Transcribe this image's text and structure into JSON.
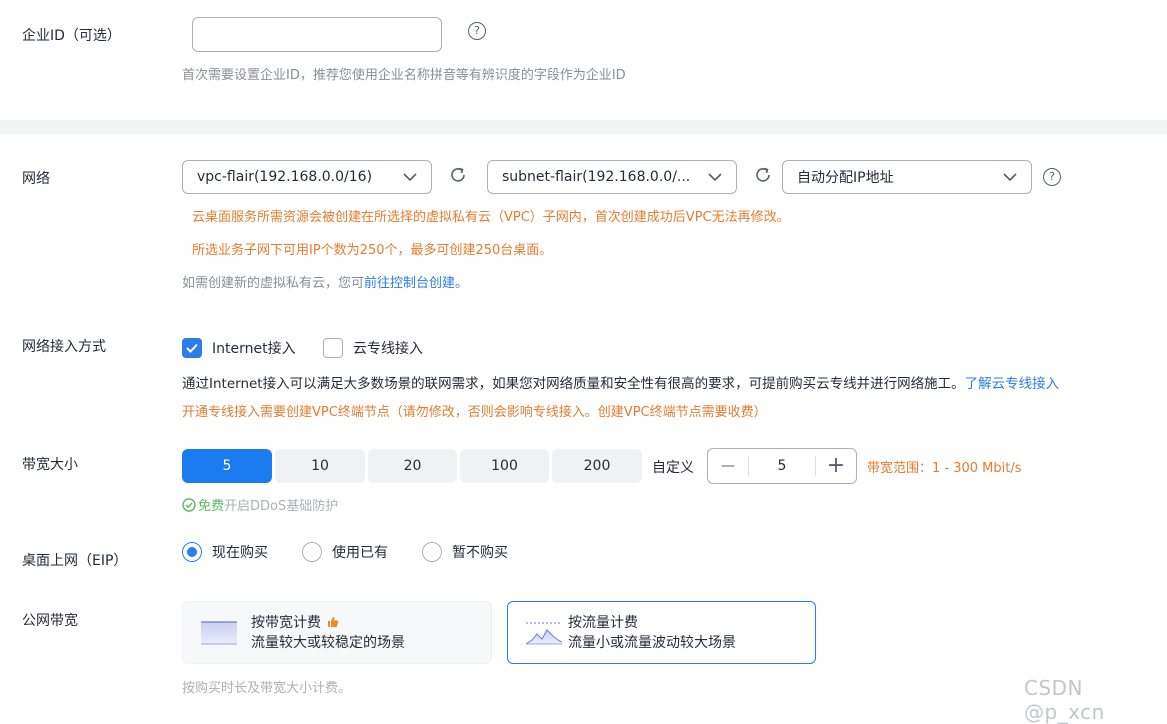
{
  "enterprise": {
    "label": "企业ID（可选）",
    "input_value": "",
    "input_placeholder": "",
    "hint": "首次需要设置企业ID，推荐您使用企业名称拼音等有辨识度的字段作为企业ID"
  },
  "network": {
    "label": "网络",
    "vpc_value": "vpc-flair(192.168.0.0/16)",
    "subnet_value": "subnet-flair(192.168.0.0/...",
    "ip_value": "自动分配IP地址",
    "warning1": "云桌面服务所需资源会被创建在所选择的虚拟私有云（VPC）子网内，首次创建成功后VPC无法再修改。",
    "warning2": "所选业务子网下可用IP个数为250个，最多可创建250台桌面。",
    "create_hint": "如需创建新的虚拟私有云，您可",
    "create_link": "前往控制台创建。"
  },
  "access": {
    "label": "网络接入方式",
    "option_internet": "Internet接入",
    "option_direct": "云专线接入",
    "desc": "通过Internet接入可以满足大多数场景的联网需求，如果您对网络质量和安全性有很高的要求，可提前购买云专线并进行网络施工。",
    "desc_link": "了解云专线接入",
    "warning": "开通专线接入需要创建VPC终端节点（请勿修改，否则会影响专线接入。创建VPC终端节点需要收费）"
  },
  "bandwidth": {
    "label": "带宽大小",
    "options": [
      "5",
      "10",
      "20",
      "100",
      "200"
    ],
    "selected": "5",
    "custom_label": "自定义",
    "stepper_value": "5",
    "minus": "—",
    "plus": "+",
    "range": "带宽范围：1 - 300 Mbit/s",
    "ddos_free": "免费",
    "ddos_text": "开启DDoS基础防护"
  },
  "eip": {
    "label": "桌面上网（EIP）",
    "options": [
      "现在购买",
      "使用已有",
      "暂不购买"
    ],
    "selected": "现在购买"
  },
  "public_bw": {
    "label": "公网带宽",
    "card1_title": "按带宽计费",
    "card1_desc": "流量较大或较稳定的场景",
    "card2_title": "按流量计费",
    "card2_desc": "流量小或流量波动较大场景",
    "footer": "按购买时长及带宽大小计费。"
  },
  "watermark": "CSDN @p_xcn",
  "colors": {
    "primary": "#2b7de9",
    "warning": "#e37d2f",
    "success": "#5cb85c"
  }
}
